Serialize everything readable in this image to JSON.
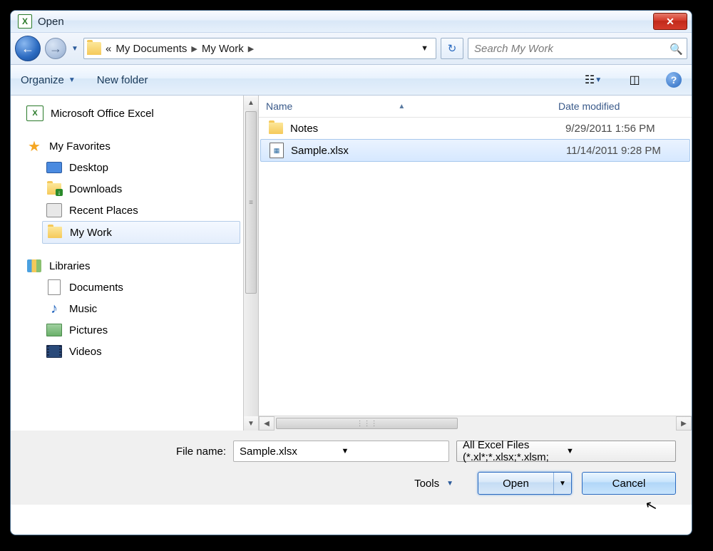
{
  "title": "Open",
  "breadcrumb": {
    "prefix": "«",
    "items": [
      "My Documents",
      "My Work"
    ]
  },
  "search": {
    "placeholder": "Search My Work"
  },
  "toolbar": {
    "organize": "Organize",
    "newfolder": "New folder"
  },
  "sidebar": {
    "excel": "Microsoft Office Excel",
    "favorites": "My Favorites",
    "fav_items": [
      "Desktop",
      "Downloads",
      "Recent Places",
      "My Work"
    ],
    "libraries": "Libraries",
    "lib_items": [
      "Documents",
      "Music",
      "Pictures",
      "Videos"
    ]
  },
  "columns": {
    "name": "Name",
    "date": "Date modified"
  },
  "files": [
    {
      "name": "Notes",
      "date": "9/29/2011 1:56 PM",
      "type": "folder"
    },
    {
      "name": "Sample.xlsx",
      "date": "11/14/2011 9:28 PM",
      "type": "xlsx",
      "selected": true
    }
  ],
  "footer": {
    "filename_label": "File name:",
    "filename_value": "Sample.xlsx",
    "filter": "All Excel Files (*.xl*;*.xlsx;*.xlsm;",
    "tools": "Tools",
    "open": "Open",
    "cancel": "Cancel"
  }
}
